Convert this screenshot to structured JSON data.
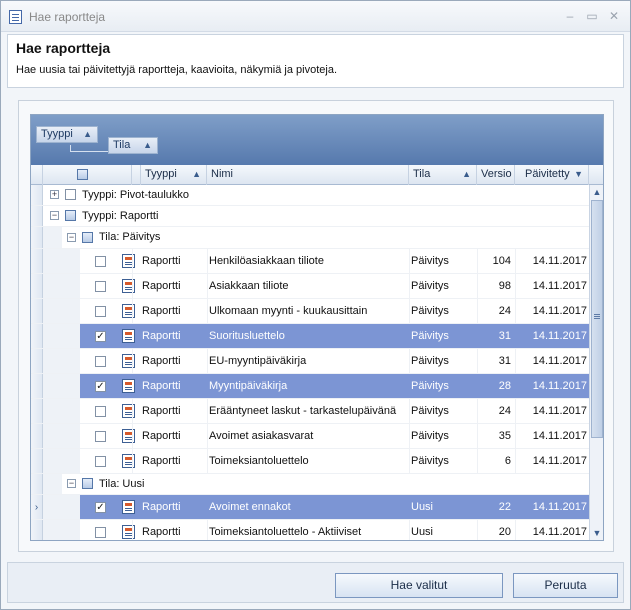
{
  "window": {
    "title": "Hae raportteja"
  },
  "header": {
    "title": "Hae raportteja",
    "subtitle": "Hae uusia tai päivitettyjä raportteja, kaavioita, näkymiä ja pivoteja."
  },
  "group_panel": {
    "chip1": "Tyyppi",
    "chip2": "Tila"
  },
  "columns": {
    "tyyppi": "Tyyppi",
    "nimi": "Nimi",
    "tila": "Tila",
    "versio": "Versio",
    "paivitetty": "Päivitetty"
  },
  "groups": {
    "pivot": "Tyyppi: Pivot-taulukko",
    "raportti": "Tyyppi: Raportti",
    "paivitys": "Tila: Päivitys",
    "uusi": "Tila: Uusi"
  },
  "rows": [
    {
      "checked": false,
      "selected": false,
      "type": "Raportti",
      "name": "Henkilöasiakkaan tiliote",
      "status": "Päivitys",
      "version": "104",
      "date": "14.11.2017"
    },
    {
      "checked": false,
      "selected": false,
      "type": "Raportti",
      "name": "Asiakkaan tiliote",
      "status": "Päivitys",
      "version": "98",
      "date": "14.11.2017"
    },
    {
      "checked": false,
      "selected": false,
      "type": "Raportti",
      "name": "Ulkomaan myynti - kuukausittain",
      "status": "Päivitys",
      "version": "24",
      "date": "14.11.2017"
    },
    {
      "checked": true,
      "selected": true,
      "type": "Raportti",
      "name": "Suoritusluettelo",
      "status": "Päivitys",
      "version": "31",
      "date": "14.11.2017"
    },
    {
      "checked": false,
      "selected": false,
      "type": "Raportti",
      "name": "EU-myyntipäiväkirja",
      "status": "Päivitys",
      "version": "31",
      "date": "14.11.2017"
    },
    {
      "checked": true,
      "selected": true,
      "type": "Raportti",
      "name": "Myyntipäiväkirja",
      "status": "Päivitys",
      "version": "28",
      "date": "14.11.2017"
    },
    {
      "checked": false,
      "selected": false,
      "type": "Raportti",
      "name": "Erääntyneet laskut - tarkastelupäivänä",
      "status": "Päivitys",
      "version": "24",
      "date": "14.11.2017"
    },
    {
      "checked": false,
      "selected": false,
      "type": "Raportti",
      "name": "Avoimet asiakasvarat",
      "status": "Päivitys",
      "version": "35",
      "date": "14.11.2017"
    },
    {
      "checked": false,
      "selected": false,
      "type": "Raportti",
      "name": "Toimeksiantoluettelo",
      "status": "Päivitys",
      "version": "6",
      "date": "14.11.2017"
    },
    {
      "checked": true,
      "selected": true,
      "type": "Raportti",
      "name": "Avoimet ennakot",
      "status": "Uusi",
      "version": "22",
      "date": "14.11.2017"
    },
    {
      "checked": false,
      "selected": false,
      "type": "Raportti",
      "name": "Toimeksiantoluettelo - Aktiiviset",
      "status": "Uusi",
      "version": "20",
      "date": "14.11.2017"
    }
  ],
  "buttons": {
    "fetch": "Hae valitut",
    "cancel": "Peruuta"
  }
}
